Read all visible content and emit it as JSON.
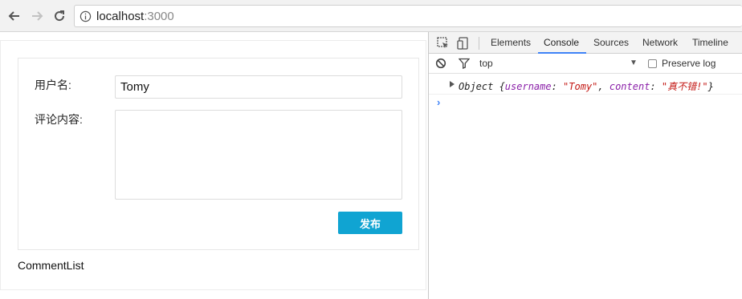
{
  "browser": {
    "url_host": "localhost",
    "url_port": ":3000"
  },
  "form": {
    "username_label": "用户名:",
    "username_value": "Tomy",
    "content_label": "评论内容:",
    "content_value": "",
    "submit_label": "发布"
  },
  "comment_list_label": "CommentList",
  "devtools": {
    "tabs": [
      "Elements",
      "Console",
      "Sources",
      "Network",
      "Timeline"
    ],
    "active_tab": "Console",
    "context": "top",
    "preserve_log_label": "Preserve log",
    "preserve_log_checked": false,
    "log": {
      "prefix": "Object {",
      "key1": "username",
      "val1": "\"Tomy\"",
      "key2": "content",
      "val2": "\"真不错!\"",
      "suffix": "}"
    },
    "prompt": "›"
  },
  "colors": {
    "accent": "#10a4d2",
    "devtools_active": "#3e82f7"
  }
}
